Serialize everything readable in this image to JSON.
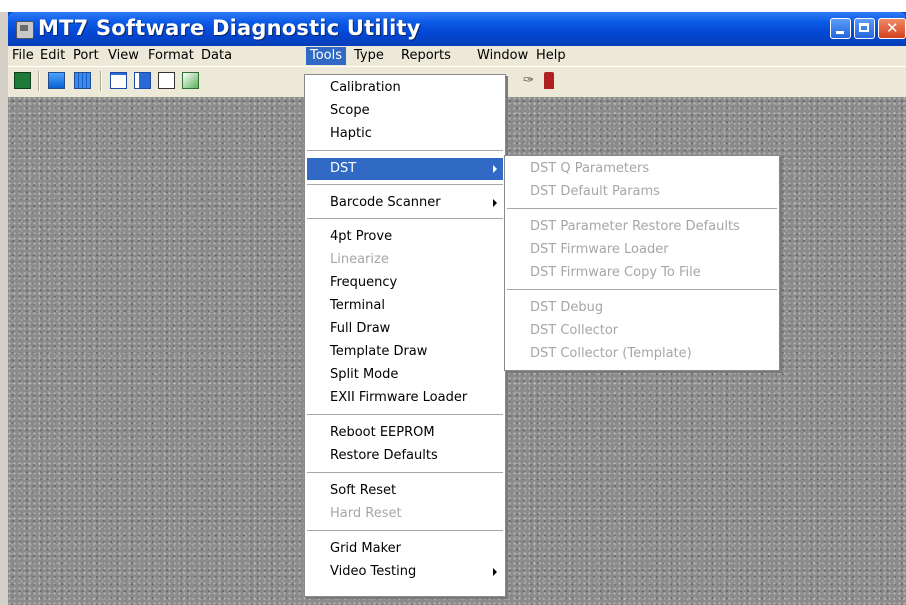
{
  "window": {
    "title": "MT7 Software Diagnostic Utility"
  },
  "menubar": [
    {
      "label": "File"
    },
    {
      "label": "Edit"
    },
    {
      "label": "Port"
    },
    {
      "label": "View"
    },
    {
      "label": "Format"
    },
    {
      "label": "Data"
    },
    {
      "label": "Tools"
    },
    {
      "label": "Type"
    },
    {
      "label": "Reports"
    },
    {
      "label": "Window"
    },
    {
      "label": "Help"
    }
  ],
  "tools_menu": [
    {
      "label": "Calibration"
    },
    {
      "label": "Scope"
    },
    {
      "label": "Haptic"
    },
    {
      "label": "DST"
    },
    {
      "label": "Barcode Scanner"
    },
    {
      "label": "4pt Prove"
    },
    {
      "label": "Linearize"
    },
    {
      "label": "Frequency"
    },
    {
      "label": "Terminal"
    },
    {
      "label": "Full Draw"
    },
    {
      "label": "Template Draw"
    },
    {
      "label": "Split Mode"
    },
    {
      "label": "EXII Firmware Loader"
    },
    {
      "label": "Reboot EEPROM"
    },
    {
      "label": "Restore Defaults"
    },
    {
      "label": "Soft Reset"
    },
    {
      "label": "Hard Reset"
    },
    {
      "label": "Grid Maker"
    },
    {
      "label": "Video Testing"
    }
  ],
  "dst_menu": [
    {
      "label": "DST Q Parameters"
    },
    {
      "label": "DST Default Params"
    },
    {
      "label": "DST Parameter Restore Defaults"
    },
    {
      "label": "DST Firmware Loader"
    },
    {
      "label": "DST Firmware Copy To File"
    },
    {
      "label": "DST Debug"
    },
    {
      "label": "DST Collector"
    },
    {
      "label": "DST Collector (Template)"
    }
  ],
  "colors": {
    "titlebar": "#0b5ae6",
    "highlight": "#316ac5",
    "menu_bg": "#ece9d8"
  }
}
